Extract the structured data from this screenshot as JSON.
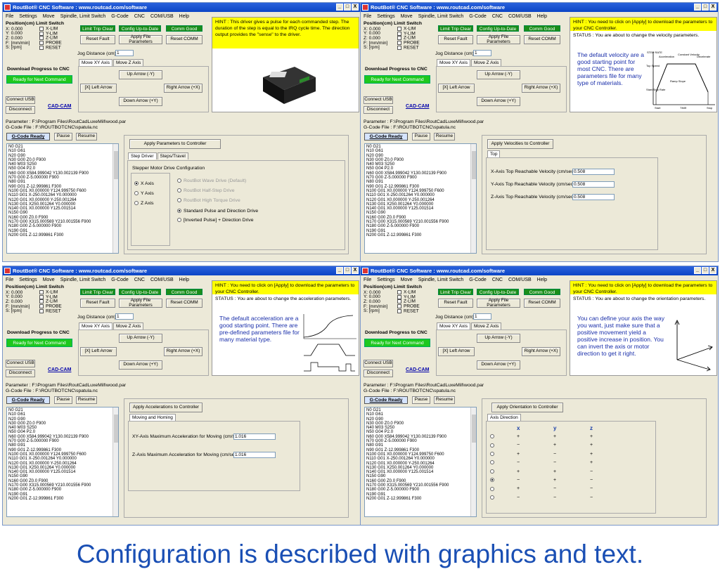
{
  "common": {
    "title": "RoutBot® CNC Software : www.routcad.com/software",
    "menu": [
      "File",
      "Settings",
      "Move",
      "Spindle, Limit Switch",
      "G-Code",
      "CNC",
      "COM/USB",
      "Help"
    ],
    "window_buttons": [
      "_",
      "□",
      "X"
    ],
    "position_header": "Position(cm) Limit Switch",
    "positions": [
      {
        "label": "X: 0.000",
        "switch": "X-LIM"
      },
      {
        "label": "Y: 0.000",
        "switch": "Y-LIM"
      },
      {
        "label": "Z: 0.000",
        "switch": "Z-LIM"
      },
      {
        "label": "F: [mm/min]",
        "switch": "PROBE"
      },
      {
        "label": "S: [rpm]",
        "switch": "RESET"
      }
    ],
    "status_buttons": [
      "Limit Trip Clear",
      "Config Up-to-Date",
      "Comm Good"
    ],
    "reset_fault": "Reset Fault",
    "apply_file_params": "Apply File Parameters",
    "reset_comm": "Reset COMM",
    "download_label": "Download Progress to CNC",
    "ready_status": "Ready for Next Command",
    "jog_label": "Jog Distance (cm):",
    "jog_value": "1",
    "move_tabs": [
      "Move XY Axis",
      "Move Z Axis"
    ],
    "up_arrow": "Up Arrow (-Y)",
    "left_arrow": "[X] Left Arrow",
    "right_arrow": "Right Arrow (+X)",
    "down_arrow": "Down Arrow (+Y)",
    "connect_usb": "Connect USB",
    "disconnect": "Disconnect",
    "cadcam": "CAD-CAM",
    "parameter_file": "Parameter : F:\\Program Files\\RoutCadLuxeMill\\wood.par",
    "gcode_file": "G-Code File : F:\\ROUTBOTCNC\\spatula.nc",
    "gcode_ready": "G-Code Ready",
    "pause": "Pause",
    "resume": "Resume",
    "gcode_lines": [
      "N0 G21",
      "N10 G61",
      "N20 G90",
      "N30 G00 Z0.0 F900",
      "N40 M03 S250",
      "N50 G04 P2.0",
      "N60 G00 X584.999042 Y130.002139 F900",
      "N70 G00 Z-5.000000 F900",
      "N80 G91",
      "N90 G01 Z-12.999861 F300",
      "N100 G01 X0.000000 Y124.999750 F600",
      "N110 G01 X-250.001264 Y0.000000",
      "N120 G01 X0.000000 Y-250.001264",
      "N130 G01 X250.001264 Y0.000000",
      "N140 G01 X0.000000 Y125.001514",
      "N150 G90",
      "N160 G00 Z0.0 F900",
      "N170 G00 X315.000569 Y210.001556 F900",
      "N180 G00 Z-5.000000 F900",
      "N190 G91",
      "N200 G01 Z-12.999861 F300"
    ]
  },
  "windows": [
    {
      "hint": "HINT : This driver gives a pulse for each commanded step. The duration of the step is equal to the IRQ cycle time. The direction output provides the \"sense\" to the driver.",
      "apply_button": "Apply Parameters to Controller",
      "tabs": [
        "Step Driver",
        "Steps/Travel"
      ],
      "group_title": "Stepper Motor Drive Configuration",
      "axes": [
        "X Axis",
        "Y Axis",
        "Z Axis"
      ],
      "drive_options": [
        "RoutBot Wave Drive (Default)",
        "RoutBot Half-Step Drive",
        "RoutBot High Torque Drive",
        "Standard Pulse and Direction Drive",
        "[Inverted Pulse] + Direction Drive"
      ]
    },
    {
      "hint": "HINT : You need to click on [Apply] to download the parameters to your CNC Controller.",
      "status": "STATUS : You are about to change the velocity parameters.",
      "big_text": "The default velocity are a good starting point for most CNC. There are parameters file for many type of materials.",
      "diagram_labels": [
        "STEP RATE",
        "Acceleration",
        "Constant Velocity",
        "Decelerate",
        "Top Speed",
        "Start/Stop Rate",
        "Ramp Slope",
        "Start",
        "TIME",
        "Stop"
      ],
      "apply_button": "Apply Velocities to Controller",
      "tab": "Top",
      "fields": [
        {
          "label": "X-Axis Top Reachable Velocity (cm/sec):",
          "value": "0.508"
        },
        {
          "label": "Y-Axis Top Reachable Velocity (cm/sec):",
          "value": "0.508"
        },
        {
          "label": "Z-Axis Top Reachable Velocity (cm/sec):",
          "value": "0.508"
        }
      ]
    },
    {
      "hint": "HINT : You need to click on [Apply] to download the parameters to your CNC Controller.",
      "status": "STATUS : You are about to change the acceleration parameters.",
      "big_text": "The default acceleration are a good starting point. There are pre-defined parameters file for many material type.",
      "apply_button": "Apply Accelerations to Controller",
      "tab": "Moving and Homing",
      "fields": [
        {
          "label": "XY-Axis Maximum Acceleration for Moving (cm/sec²):",
          "value": "1.016"
        },
        {
          "label": "Z-Axis Maximum Acceleration for Moving (cm/sec²):",
          "value": "1.016"
        }
      ]
    },
    {
      "hint": "HINT : You need to click on [Apply] to download the parameters to your CNC Controller.",
      "status": "STATUS : You are about to change the orientation parameters.",
      "big_text": "You can define your axis the way you want, just make sure that a positive movement yield a positive increase in position. You can invert the axis or motor direction to get it right.",
      "apply_button": "Apply Orientation to Controller",
      "tab": "Axis Direction",
      "columns": [
        "x",
        "y",
        "z"
      ],
      "rows": [
        [
          "+",
          "+",
          "+"
        ],
        [
          "−",
          "+",
          "+"
        ],
        [
          "+",
          "−",
          "+"
        ],
        [
          "−",
          "−",
          "+"
        ],
        [
          "+",
          "+",
          "−"
        ],
        [
          "−",
          "+",
          "−"
        ],
        [
          "+",
          "−",
          "−"
        ],
        [
          "−",
          "−",
          "−"
        ]
      ],
      "selected_row": 5
    }
  ],
  "caption": "Configuration is described with graphics and text."
}
